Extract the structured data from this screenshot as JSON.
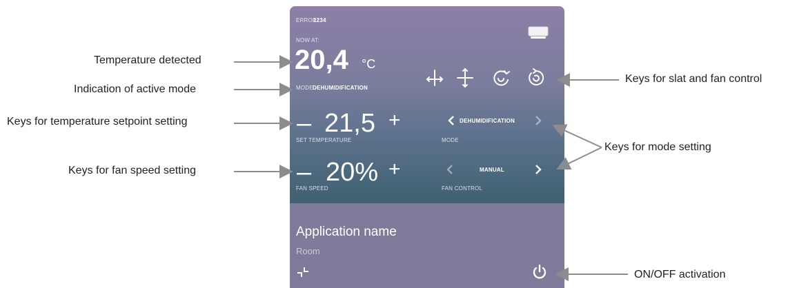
{
  "panel": {
    "error_label": "ERROR:",
    "error_code": "1234",
    "now_label": "NOW AT:",
    "temp_value": "20,4",
    "temp_unit": "°C",
    "mode_label": "MODE",
    "mode_value": "DEHUMIDIFICATION",
    "setpoint": {
      "minus": "–",
      "value": "21,5",
      "plus": "+",
      "label": "SET TEMPERATURE"
    },
    "mode_selector": {
      "value": "DEHUMIDIFICATION",
      "label": "MODE"
    },
    "fan_speed": {
      "minus": "–",
      "value": "20%",
      "plus": "+",
      "label": "FAN SPEED"
    },
    "fan_control": {
      "value": "MANUAL",
      "label": "FAN CONTROL"
    },
    "app_name": "Application name",
    "room": "Room",
    "icons": [
      "ac-unit-icon",
      "slat-horizontal-icon",
      "slat-vertical-icon",
      "swing-icon",
      "rotate-icon",
      "collapse-icon",
      "power-icon"
    ]
  },
  "annotations": {
    "temperature_detected": "Temperature detected",
    "active_mode": "Indication of active mode",
    "setpoint_keys": "Keys for temperature setpoint setting",
    "fan_speed_keys": "Keys for fan speed setting",
    "slat_fan_keys": "Keys for slat and fan control",
    "mode_keys": "Keys for mode setting",
    "onoff": "ON/OFF activation"
  },
  "colors": {
    "panel_top": "#8e7fa8",
    "panel_gradient_end": "#3f6170",
    "panel_bottom": "#7f7a99",
    "leader": "#8c8c8c",
    "text_white": "#ffffff"
  }
}
